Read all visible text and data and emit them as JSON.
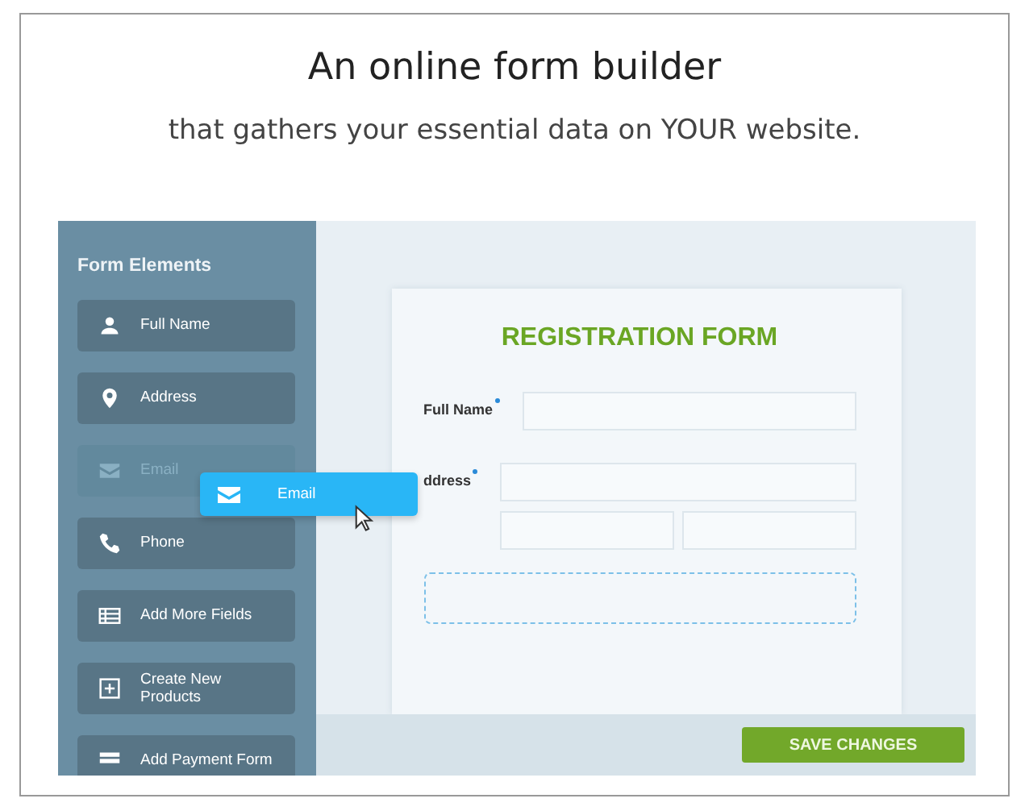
{
  "headline": "An online form builder",
  "subheadline": "that gathers your essential data on YOUR website.",
  "sidebar": {
    "title": "Form Elements",
    "items": [
      {
        "label": "Full Name",
        "kind": "person",
        "dragging": false
      },
      {
        "label": "Address",
        "kind": "pin",
        "dragging": false
      },
      {
        "label": "Email",
        "kind": "mail",
        "dragging": true
      },
      {
        "label": "Phone",
        "kind": "phone",
        "dragging": false
      },
      {
        "label": "Add More Fields",
        "kind": "table",
        "dragging": false
      },
      {
        "label": "Create New Products",
        "kind": "plus",
        "dragging": false
      },
      {
        "label": "Add Payment Form",
        "kind": "card",
        "dragging": false
      }
    ]
  },
  "dragged_item": {
    "label": "Email",
    "kind": "mail"
  },
  "form": {
    "title": "REGISTRATION FORM",
    "fields": [
      {
        "label": "Full Name",
        "required": true,
        "kind": "single"
      },
      {
        "label": "ddress",
        "required": true,
        "kind": "split"
      }
    ]
  },
  "save_button": "SAVE CHANGES"
}
